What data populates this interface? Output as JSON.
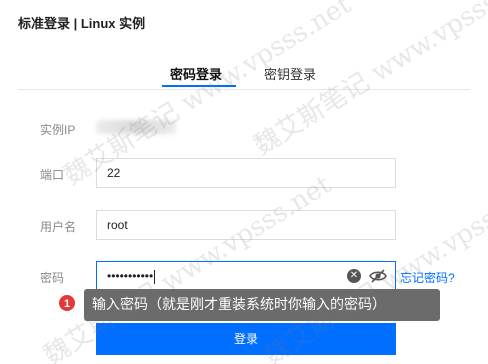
{
  "page": {
    "title": "标准登录 | Linux 实例"
  },
  "tabs": [
    {
      "label": "密码登录",
      "active": true
    },
    {
      "label": "密钥登录",
      "active": false
    }
  ],
  "form": {
    "ip_label": "实例IP",
    "port_label": "端口",
    "port_value": "22",
    "username_label": "用户名",
    "username_value": "root",
    "password_label": "密码",
    "password_masked": "•••••••••••",
    "clear_icon": "x-circle-icon",
    "toggle_icon": "eye-off-icon",
    "forgot_link": "忘记密码?",
    "submit_label": "登录"
  },
  "annotation": {
    "badge": "1",
    "text": "输入密码（就是刚才重装系统时你输入的密码）"
  },
  "watermark": {
    "text": "魏艾斯笔记 www.vpsss.net"
  },
  "colors": {
    "accent": "#006eff",
    "badge": "#e23a3a",
    "tooltip_bg": "#6b6b6b"
  }
}
